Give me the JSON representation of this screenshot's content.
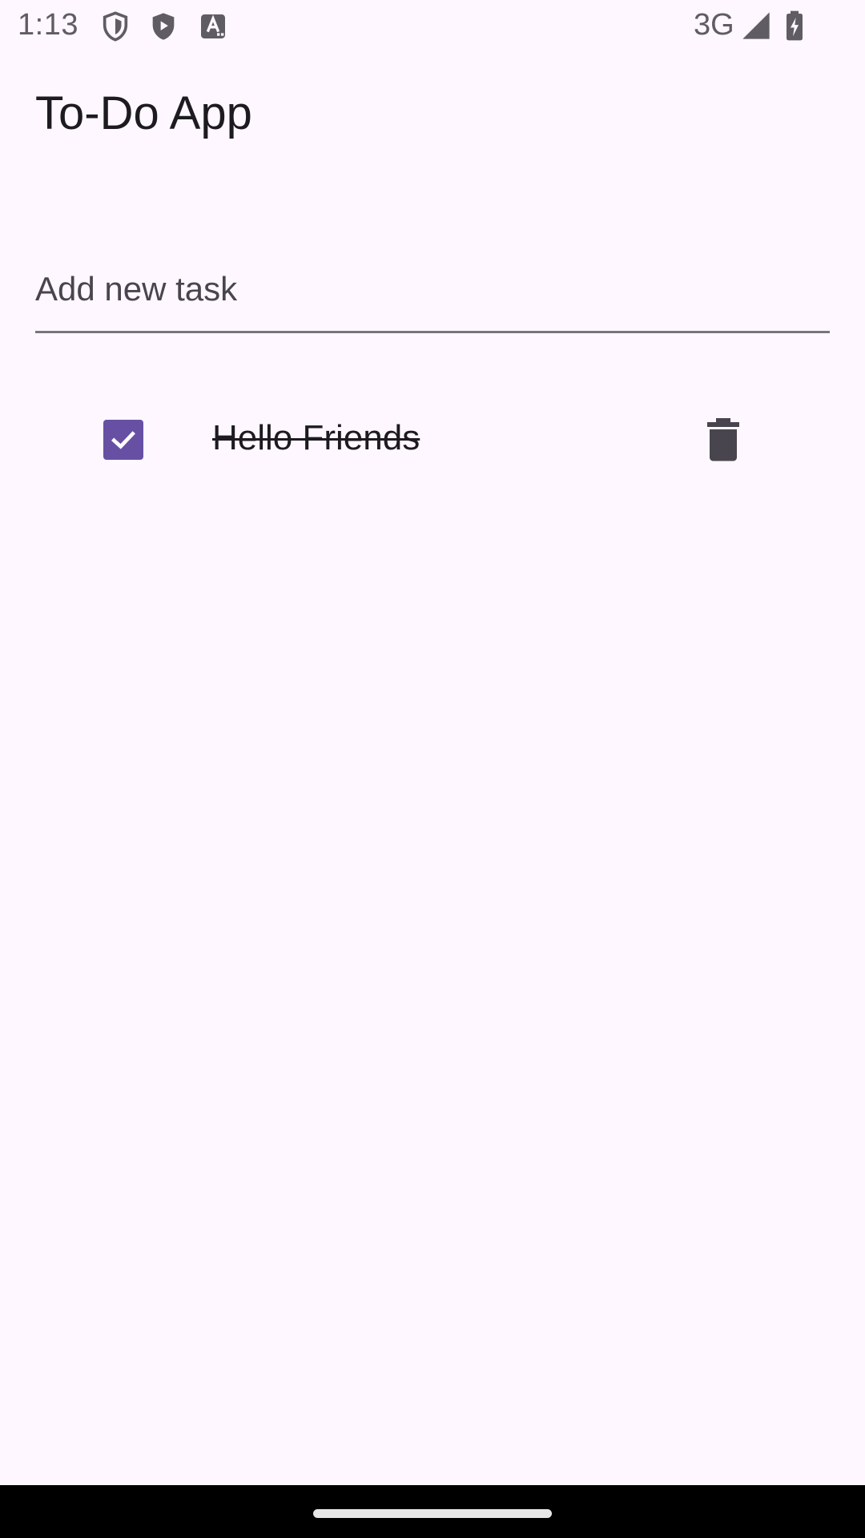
{
  "status_bar": {
    "time": "1:13",
    "network": "3G",
    "icons": [
      "shield-icon",
      "play-protect-icon",
      "text-assistant-icon",
      "cell-signal-icon",
      "battery-charging-icon"
    ]
  },
  "app": {
    "title": "To-Do App"
  },
  "new_task": {
    "placeholder": "Add new task",
    "value": ""
  },
  "tasks": [
    {
      "label": "Hello Friends",
      "completed": true,
      "checkbox_icon": "check-icon",
      "delete_icon": "trash-icon"
    }
  ],
  "colors": {
    "background": "#FEF7FF",
    "accent": "#6750A4",
    "text": "#1D1B20",
    "icon": "#49454F",
    "underline": "#79747E"
  }
}
